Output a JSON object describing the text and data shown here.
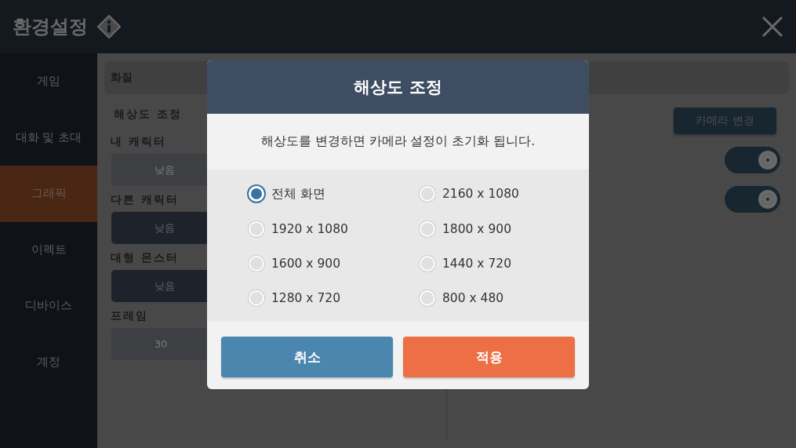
{
  "header": {
    "title": "환경설정"
  },
  "sidebar": {
    "items": [
      {
        "label": "게임",
        "selected": false
      },
      {
        "label": "대화 및 초대",
        "selected": false
      },
      {
        "label": "그래픽",
        "selected": true
      },
      {
        "label": "이펙트",
        "selected": false
      },
      {
        "label": "디바이스",
        "selected": false
      },
      {
        "label": "계정",
        "selected": false
      }
    ]
  },
  "section": {
    "title": "화질"
  },
  "settings": [
    {
      "kind": "heading",
      "label": "해상도 조정"
    },
    {
      "kind": "choice",
      "label": "내 캐릭터",
      "value": "낮음",
      "disabled": true
    },
    {
      "kind": "choice",
      "label": "다른 캐릭터",
      "value": "낮음",
      "disabled": false
    },
    {
      "kind": "choice",
      "label": "대형 몬스터",
      "value": "낮음",
      "disabled": false
    },
    {
      "kind": "choice",
      "label": "프레임",
      "value": "30",
      "disabled": true
    }
  ],
  "right_panel": {
    "camera_button": "카메라 변경",
    "toggles": [
      {
        "on": true
      },
      {
        "on": true
      }
    ]
  },
  "dialog": {
    "title": "해상도 조정",
    "message": "해상도를 변경하면 카메라 설정이 초기화 됩니다.",
    "options": [
      {
        "label": "전체 화면",
        "selected": true
      },
      {
        "label": "2160 x 1080",
        "selected": false
      },
      {
        "label": "1920 x 1080",
        "selected": false
      },
      {
        "label": "1800 x 900",
        "selected": false
      },
      {
        "label": "1600 x 900",
        "selected": false
      },
      {
        "label": "1440 x 720",
        "selected": false
      },
      {
        "label": "1280 x 720",
        "selected": false
      },
      {
        "label": "800 x 480",
        "selected": false
      }
    ],
    "buttons": [
      {
        "kind": "cancel",
        "label": "취소"
      },
      {
        "kind": "confirm",
        "label": "적용"
      }
    ]
  }
}
